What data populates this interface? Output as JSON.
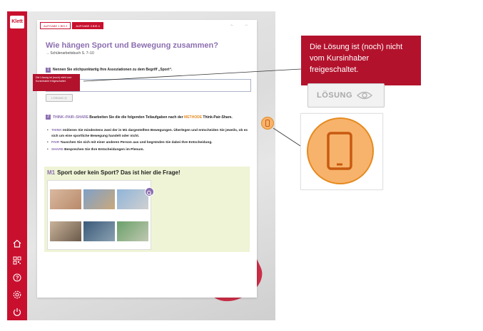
{
  "app": {
    "logo_text": "Klett"
  },
  "rail": {
    "icons": [
      "home-icon",
      "qr-code-icon",
      "help-icon",
      "settings-icon",
      "power-icon"
    ]
  },
  "sheet": {
    "tabs": [
      {
        "label": "AUFGABE 1 BIS 2",
        "active": false
      },
      {
        "label": "AUFGABE 3 BIS 4",
        "active": true
      }
    ],
    "nav_arrows": "← →",
    "title": "Wie hängen Sport und Bewegung zusammen?",
    "reference": "→ Schülerarbeitsbuch S. 7–10",
    "task1": {
      "number": "1",
      "text": "Nennen Sie stichpunktartig Ihre Assoziationen zu dem Begriff „Sport“."
    },
    "small_popup_text": "Die Lösung ist (noch) nicht vom Kursinhaber freigeschaltet.",
    "small_solution_label": "LÖSUNG",
    "task2": {
      "number": "2",
      "method_label": "THINK–PAIR–SHARE",
      "text_a": " Bearbeiten Sie die die folgenden Teilaufgaben nach der ",
      "method_word": "METHODE",
      "text_b": " Think-Pair-Share."
    },
    "bullets": [
      {
        "kw": "THINK",
        "text": " Imitieren Sie mindestens zwei der in M1 dargestellten Bewegungen. Überlegen und entscheiden Sie jeweils, ob es sich um eine sportliche Bewegung handelt oder nicht."
      },
      {
        "kw": "PAIR",
        "text": " Tauschen Sie sich mit einer anderen Person aus und begründen Sie dabei Ihre Entscheidung."
      },
      {
        "kw": "SHARE",
        "text": " Besprechen Sie Ihre Entscheidungen im Plenum."
      }
    ],
    "m1": {
      "label": "M1",
      "title": "Sport oder kein Sport? Das ist hier die Frage!"
    }
  },
  "callout": {
    "popup_text": "Die Lösung ist (noch) nicht vom Kursinhaber freigeschaltet.",
    "solution_label": "LÖSUNG"
  },
  "colors": {
    "brand_red": "#c8102e",
    "purple": "#8c6fb0",
    "orange": "#e58a1f",
    "m1_background": "#eef4d5"
  }
}
